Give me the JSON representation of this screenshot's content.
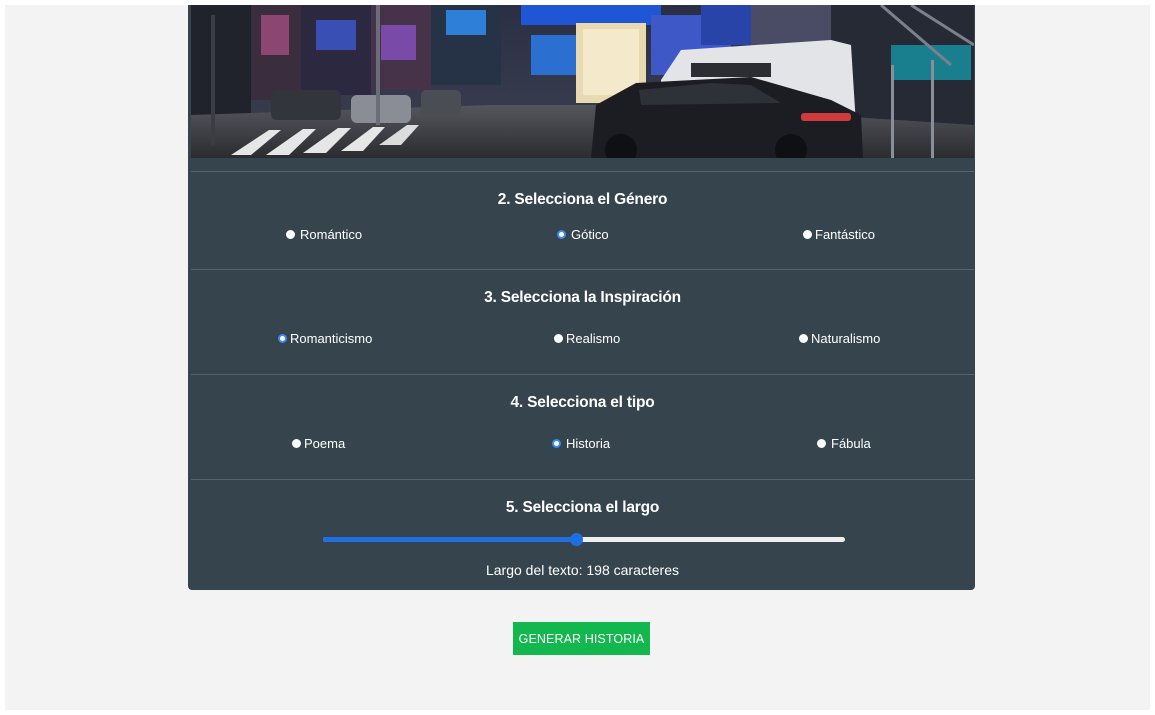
{
  "hero": {
    "image": "street-photo"
  },
  "sections": {
    "genre": {
      "title": "2. Selecciona el Género",
      "options": [
        {
          "label": "Romántico",
          "checked": false
        },
        {
          "label": "Gótico",
          "checked": true
        },
        {
          "label": "Fantástico",
          "checked": false
        }
      ]
    },
    "inspiration": {
      "title": "3. Selecciona la Inspiración",
      "options": [
        {
          "label": "Romanticismo",
          "checked": true
        },
        {
          "label": "Realismo",
          "checked": false
        },
        {
          "label": "Naturalismo",
          "checked": false
        }
      ]
    },
    "type": {
      "title": "4. Selecciona el tipo",
      "options": [
        {
          "label": "Poema",
          "checked": false
        },
        {
          "label": "Historia",
          "checked": true
        },
        {
          "label": "Fábula",
          "checked": false
        }
      ]
    },
    "length": {
      "title": "5. Selecciona el largo",
      "slider_value_fraction": 0.485,
      "label_prefix": "Largo del texto: ",
      "value": "198",
      "unit": " caracteres"
    }
  },
  "generate_button": {
    "label": "GENERAR HISTORIA"
  },
  "colors": {
    "card_bg": "#36444d",
    "page_bg": "#f3f3f3",
    "accent": "#1f6fe0",
    "button_bg": "#12b84e"
  }
}
